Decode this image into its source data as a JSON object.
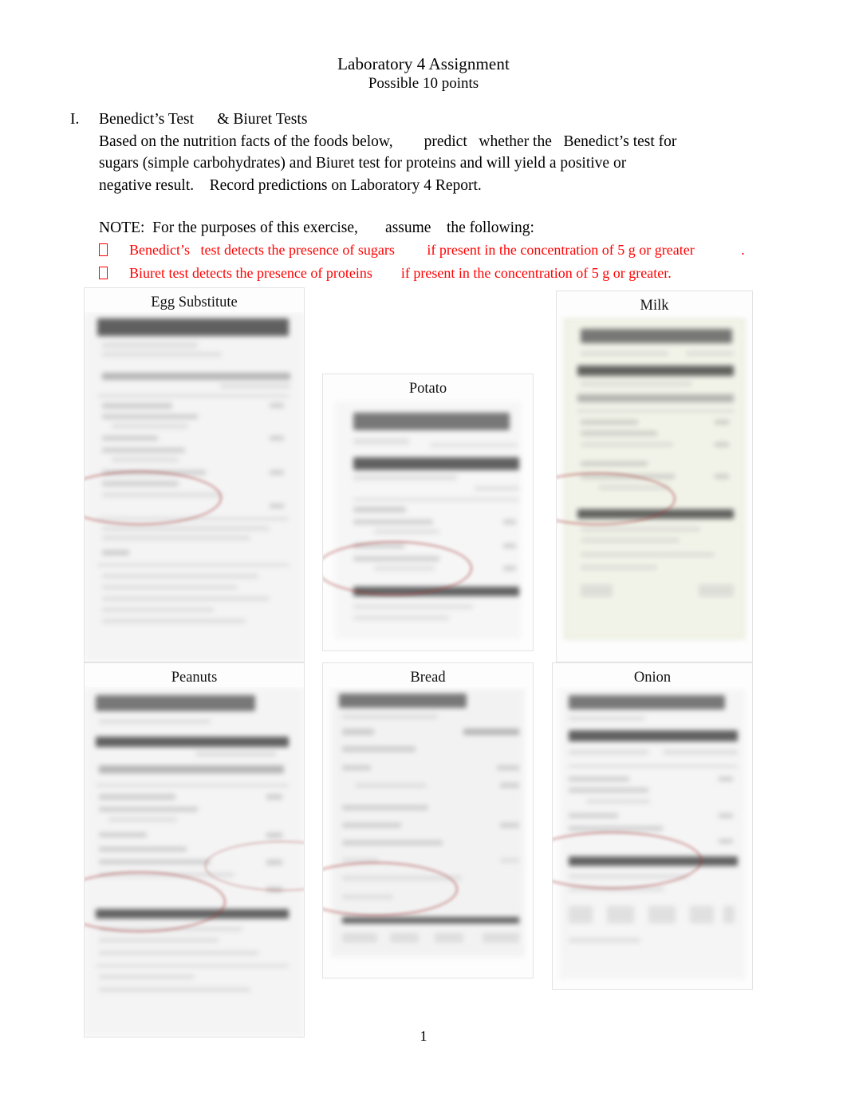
{
  "document": {
    "title": "Laboratory 4 Assignment",
    "subtitle": "Possible 10 points",
    "page_number": "1"
  },
  "section": {
    "numeral": "I.",
    "heading": "Benedict’s Test      & Biuret Tests",
    "paragraph_lines": [
      "Based on the nutrition facts of the foods below,        predict   whether the   Benedict’s test for",
      "sugars (simple carbohydrates) and Biuret test for proteins and will yield a positive or",
      "negative result.    Record predictions on Laboratory 4 Report."
    ]
  },
  "note": {
    "lead": "NOTE:  For the purposes of this exercise,       assume    the following:",
    "bullet_glyph": "missing-glyph-box",
    "bullets": [
      "Benedict’s   test detects the presence of sugars         if present in the concentration of 5 g or greater             .",
      "Biuret test detects the presence of proteins        if present in the concentration of 5 g or greater."
    ],
    "bullet_color": "#ff0000"
  },
  "food_panels": [
    {
      "caption": "Egg Substitute",
      "image": "nutrition-facts-label-egg-substitute",
      "tint": "none"
    },
    {
      "caption": "Potato",
      "image": "nutrition-facts-label-potato",
      "tint": "none"
    },
    {
      "caption": "Milk",
      "image": "nutrition-facts-label-milk",
      "tint": "green"
    },
    {
      "caption": "Peanuts",
      "image": "nutrition-facts-label-peanuts",
      "tint": "none"
    },
    {
      "caption": "Bread",
      "image": "nutrition-facts-label-bread",
      "tint": "none"
    },
    {
      "caption": "Onion",
      "image": "nutrition-facts-label-onion",
      "tint": "none"
    }
  ]
}
